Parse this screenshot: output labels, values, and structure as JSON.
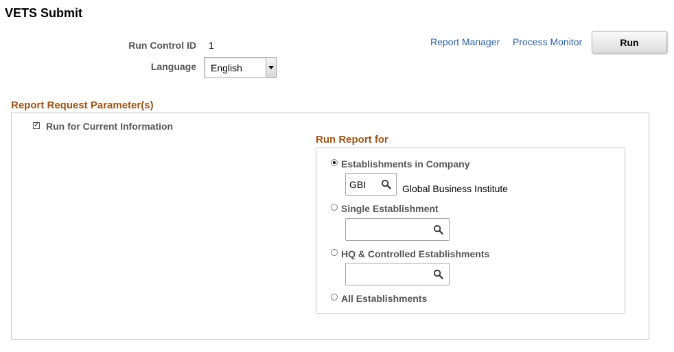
{
  "page": {
    "title": "VETS Submit"
  },
  "header": {
    "run_control_label": "Run Control ID",
    "run_control_value": "1",
    "language_label": "Language",
    "language_value": "English",
    "report_manager_link": "Report Manager",
    "process_monitor_link": "Process Monitor",
    "run_button": "Run"
  },
  "params": {
    "section_title": "Report Request Parameter(s)",
    "run_current_label": "Run for Current Information",
    "run_current_checked": true
  },
  "run_report_for": {
    "title": "Run Report for",
    "options": [
      {
        "label": "Establishments in Company",
        "selected": true,
        "field_value": "GBI",
        "field_description": "Global Business Institute"
      },
      {
        "label": "Single Establishment",
        "selected": false,
        "field_value": ""
      },
      {
        "label": "HQ & Controlled Establishments",
        "selected": false,
        "field_value": ""
      },
      {
        "label": "All Establishments",
        "selected": false
      }
    ]
  },
  "icons": {
    "lookup": "search-icon",
    "checkbox_mark": "checkmark-icon",
    "dropdown": "chevron-down-icon"
  },
  "colors": {
    "section_title": "#9a5418",
    "link": "#2b61a8"
  }
}
